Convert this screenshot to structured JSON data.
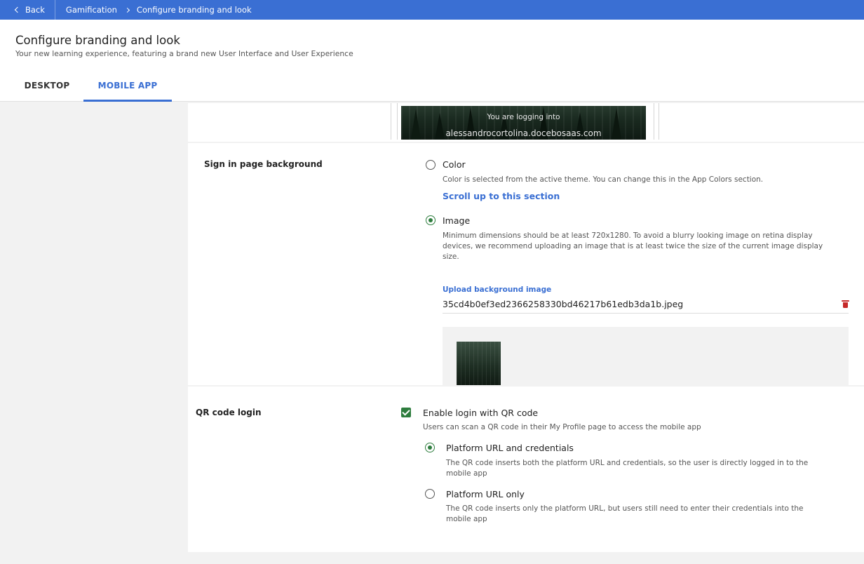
{
  "topbar": {
    "back_label": "Back",
    "breadcrumb": [
      "Gamification",
      "Configure branding and look"
    ]
  },
  "header": {
    "title": "Configure branding and look",
    "subtitle": "Your new learning experience, featuring a brand new User Interface and User Experience",
    "tabs": [
      {
        "label": "DESKTOP",
        "active": false
      },
      {
        "label": "MOBILE APP",
        "active": true
      }
    ]
  },
  "preview": {
    "line1": "You are logging into",
    "line2": "alessandrocortolina.docebosaas.com"
  },
  "sign_in_background": {
    "section_label": "Sign in page background",
    "color_option": {
      "label": "Color",
      "description": "Color is selected from the active theme. You can change this in the App Colors section.",
      "link": "Scroll up to this section",
      "selected": false
    },
    "image_option": {
      "label": "Image",
      "description": "Minimum dimensions should be at least 720x1280. To avoid a blurry looking image on retina display devices, we recommend uploading an image that is at least twice the size of the current image display size.",
      "selected": true
    },
    "upload": {
      "label": "Upload background image",
      "filename": "35cd4b0ef3ed2366258330bd46217b61edb3da1b.jpeg"
    }
  },
  "qr_login": {
    "section_label": "QR code login",
    "enable": {
      "label": "Enable login with QR code",
      "description": "Users can scan a QR code in their My Profile page to access the mobile app",
      "checked": true
    },
    "options": [
      {
        "label": "Platform URL and credentials",
        "description": "The QR code inserts both the platform URL and credentials, so the user is directly logged in to the mobile app",
        "selected": true
      },
      {
        "label": "Platform URL only",
        "description": "The QR code inserts only the platform URL, but users still need to enter their credentials into the mobile app",
        "selected": false
      }
    ]
  },
  "colors": {
    "accent": "#3a6fd3",
    "selected": "#2e7d3e",
    "delete": "#c62828"
  }
}
